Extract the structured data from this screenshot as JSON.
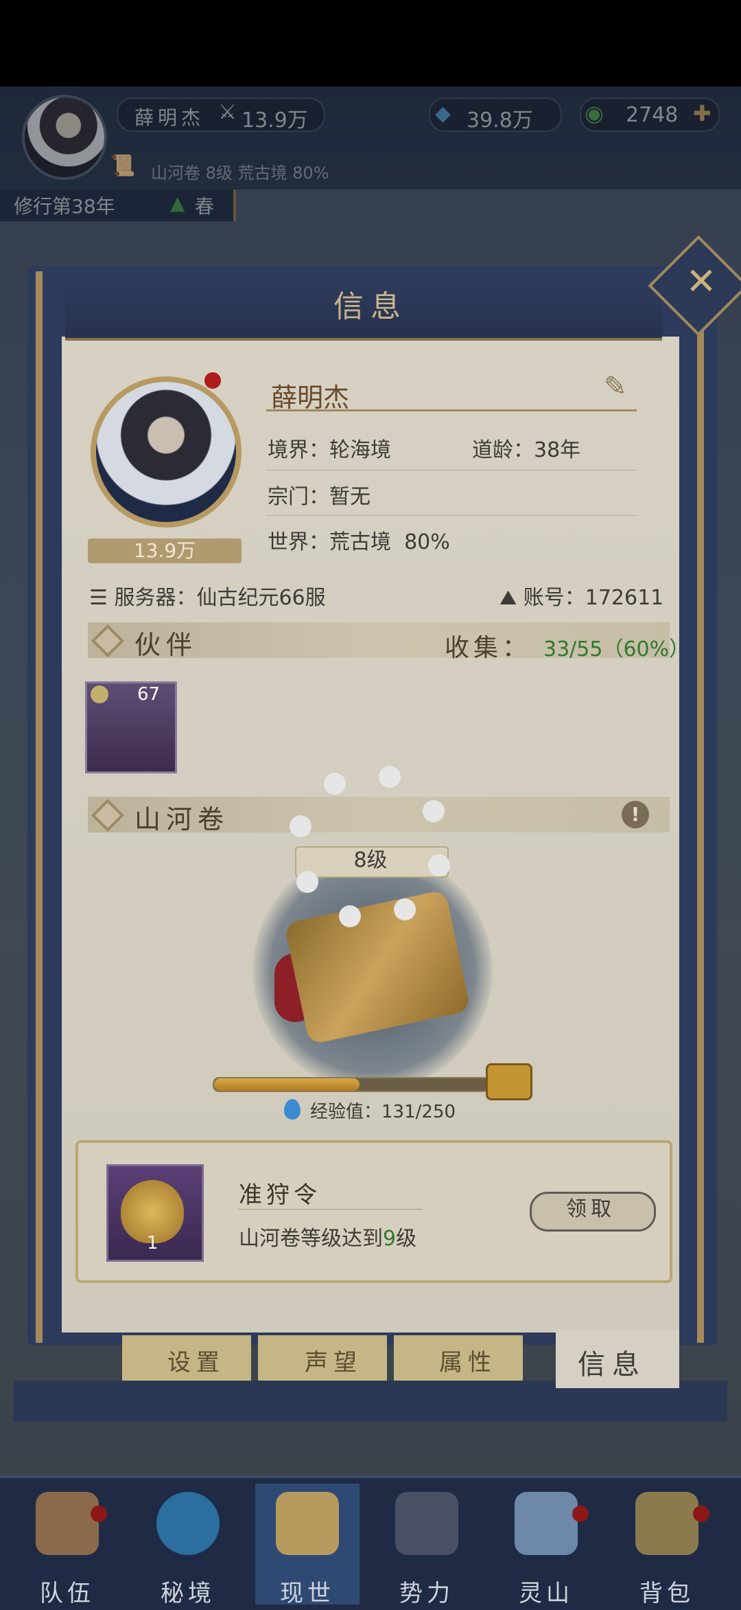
{
  "header": {
    "player_name": "薛明杰",
    "power": "13.9万",
    "spirit_stones": "39.8万",
    "jade": "2748",
    "subtitle": "山河卷 8级 荒古境 80%",
    "year": "修行第38年",
    "season": "春"
  },
  "modal": {
    "title": "信息",
    "profile": {
      "name": "薛明杰",
      "power": "13.9万",
      "realm_label": "境界：",
      "realm_value": "轮海境",
      "dao_age_label": "道龄：",
      "dao_age_value": "38年",
      "sect_label": "宗门：",
      "sect_value": "暂无",
      "world_label": "世界：",
      "world_value": "荒古境",
      "world_pct": "80%",
      "server_label": "服务器：",
      "server_value": "仙古纪元66服",
      "account_label": "账号：",
      "account_value": "172611"
    },
    "companions": {
      "title": "伙伴",
      "collect_label": "收集：",
      "collect_value": "33/55（60%）",
      "card_level": "67"
    },
    "scroll": {
      "title": "山河卷",
      "alert": "!",
      "level": "8级",
      "xp_label": "经验值：",
      "xp_value": "131/250",
      "xp_fraction": 0.524
    },
    "reward": {
      "title": "准狩令",
      "icon_count": "1",
      "desc_prefix": "山河卷等级达到",
      "desc_level": "9",
      "desc_suffix": "级",
      "claim_label": "领取"
    },
    "tabs": [
      "设置",
      "声望",
      "属性",
      "信息"
    ]
  },
  "bottom_nav": [
    "队伍",
    "秘境",
    "现世",
    "势力",
    "灵山",
    "背包"
  ],
  "colors": {
    "accent_green": "#2f7a2f",
    "gold": "#c9b48a",
    "navy": "#2c3b5b",
    "badge_red": "#b01b1b"
  }
}
